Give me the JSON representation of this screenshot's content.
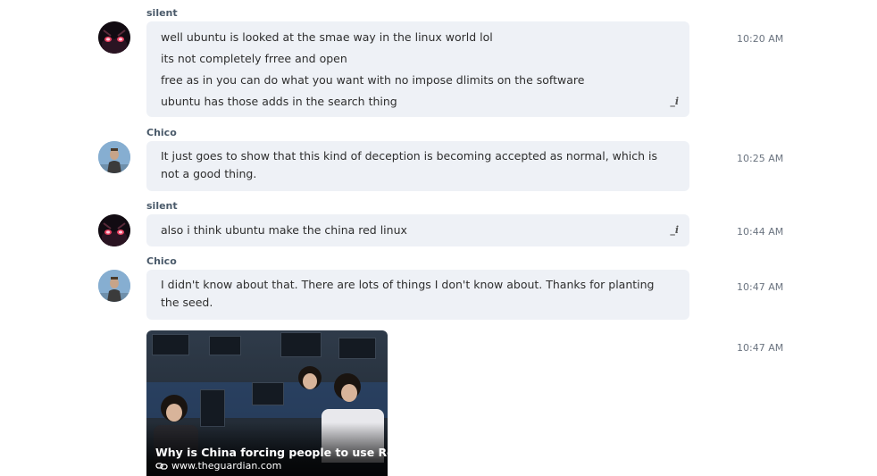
{
  "messages": [
    {
      "author": "silent",
      "time": "10:20 AM",
      "lines": [
        "well ubuntu is looked at the smae way in the linux world lol",
        "its not completely frree and open",
        "free as in  you can  do what you want with no impose dlimits on the software",
        "ubuntu has those adds in the search thing"
      ]
    },
    {
      "author": "Chico",
      "time": "10:25 AM",
      "text": "It just goes to show that this kind of deception is becoming accepted as normal, which is not a good thing."
    },
    {
      "author": "silent",
      "time": "10:44 AM",
      "text": "also i think ubuntu make the china red linux"
    },
    {
      "author": "Chico",
      "time": "10:47 AM",
      "text": "I didn't know about that.  There are lots of things I don't know about.  Thanks for planting the seed."
    }
  ],
  "link_preview": {
    "time": "10:47 AM",
    "title": "Why is China forcing people to use Re...",
    "domain": "www.theguardian.com",
    "icon": "link-icon"
  },
  "icons": {
    "edit": "edit-pencil-icon"
  },
  "colors": {
    "bubble_bg": "#eef1f6",
    "author_name": "#4a5a6a",
    "timestamp": "#6b7480"
  }
}
